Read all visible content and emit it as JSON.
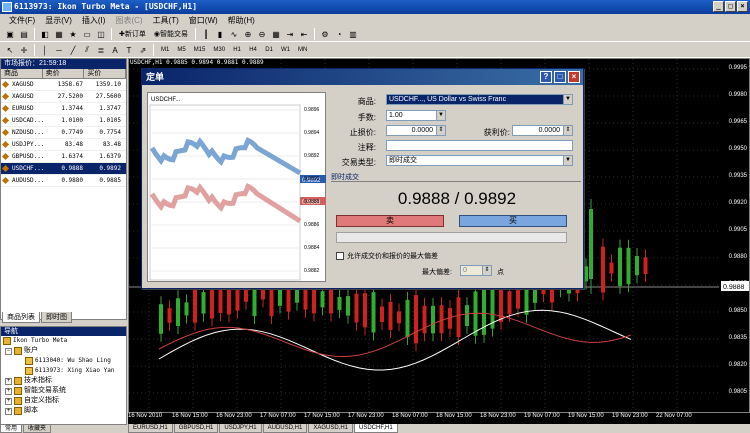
{
  "window": {
    "title": "6113973: Ikon Turbo Meta - [USDCHF,H1]"
  },
  "menu": [
    "文件(F)",
    "显示(V)",
    "插入(I)",
    "图表(C)",
    "工具(T)",
    "窗口(W)",
    "帮助(H)"
  ],
  "toolbar2": {
    "new_order": "新订单",
    "expert": "智能交易",
    "timeframes": [
      "M1",
      "M5",
      "M15",
      "M30",
      "H1",
      "H4",
      "D1",
      "W1",
      "MN"
    ]
  },
  "market_watch": {
    "title": "市场报价：21:59:18",
    "columns": [
      "商品",
      "卖价",
      "买价"
    ],
    "rows": [
      {
        "sym": "XAGUSD",
        "bid": "1358.67",
        "ask": "1359.10"
      },
      {
        "sym": "XAGUSD",
        "bid": "27.5200",
        "ask": "27.5600"
      },
      {
        "sym": "EURUSD",
        "bid": "1.3744",
        "ask": "1.3747"
      },
      {
        "sym": "USDCAD...",
        "bid": "1.0100",
        "ask": "1.0105"
      },
      {
        "sym": "NZDUSD...",
        "bid": "0.7749",
        "ask": "0.7754"
      },
      {
        "sym": "USDJPY...",
        "bid": "83.48",
        "ask": "83.48"
      },
      {
        "sym": "GBPUSD...",
        "bid": "1.6374",
        "ask": "1.6379"
      },
      {
        "sym": "USDCHF...",
        "bid": "0.9888",
        "ask": "0.9892"
      },
      {
        "sym": "AUDUSD...",
        "bid": "0.9880",
        "ask": "0.9885"
      }
    ],
    "tabs": [
      "商品列表",
      "即时图"
    ]
  },
  "navigator": {
    "title": "导航",
    "root": "Ikon Turbo Meta",
    "accounts_label": "账户",
    "accounts": [
      "6113040: Wu Shao Ling",
      "6113973: Xing Xiao Yan"
    ],
    "items": [
      "技术指标",
      "智能交易系统",
      "自定义指标",
      "脚本"
    ],
    "tabs": [
      "常用",
      "收藏夹"
    ]
  },
  "chart": {
    "header": "USDCHF,H1  0.9885 0.9894 0.9881 0.9889",
    "price_ticks": [
      "0.9995",
      "0.9980",
      "0.9965",
      "0.9950",
      "0.9935",
      "0.9920",
      "0.9905",
      "0.9880",
      "0.9865",
      "0.9850",
      "0.9835",
      "0.9820",
      "0.9805"
    ],
    "current_price": "0.9888",
    "dates": [
      "16 Nov 2010",
      "16 Nov 15:00",
      "16 Nov 23:00",
      "17 Nov 07:00",
      "17 Nov 15:00",
      "17 Nov 23:00",
      "18 Nov 07:00",
      "18 Nov 15:00",
      "18 Nov 23:00",
      "19 Nov 07:00",
      "19 Nov 15:00",
      "19 Nov 23:00",
      "22 Nov 07:00"
    ],
    "tabs": [
      "EURUSD,H1",
      "GBPUSD,H1",
      "USDJPY,H1",
      "AUDUSD,H1",
      "XAGUSD,H1",
      "USDCHF,H1"
    ]
  },
  "dialog": {
    "title": "定单",
    "mini_chart_label": "USDCHF...",
    "mini_price_ticks": [
      "0.9896",
      "0.9894",
      "0.9892",
      "0.9890",
      "0.9888",
      "0.9886",
      "0.9884",
      "0.9882"
    ],
    "mini_highlight_ask": "0.9892",
    "mini_highlight_bid": "0.9888",
    "symbol_label": "商品:",
    "symbol_value": "USDCHF..., US Dollar vs Swiss Franc",
    "volume_label": "手数:",
    "volume_value": "1.00",
    "sl_label": "止损价:",
    "sl_value": "0.0000",
    "tp_label": "获利价:",
    "tp_value": "0.0000",
    "comment_label": "注释:",
    "type_label": "交易类型:",
    "type_value": "即时成交",
    "section": "即时成交",
    "price": "0.9888 / 0.9892",
    "sell": "卖",
    "buy": "买",
    "deviation_check": "允许成交价和报价的最大偏差",
    "max_dev_label": "最大偏差:",
    "max_dev_value": "0",
    "max_dev_unit": "点"
  }
}
